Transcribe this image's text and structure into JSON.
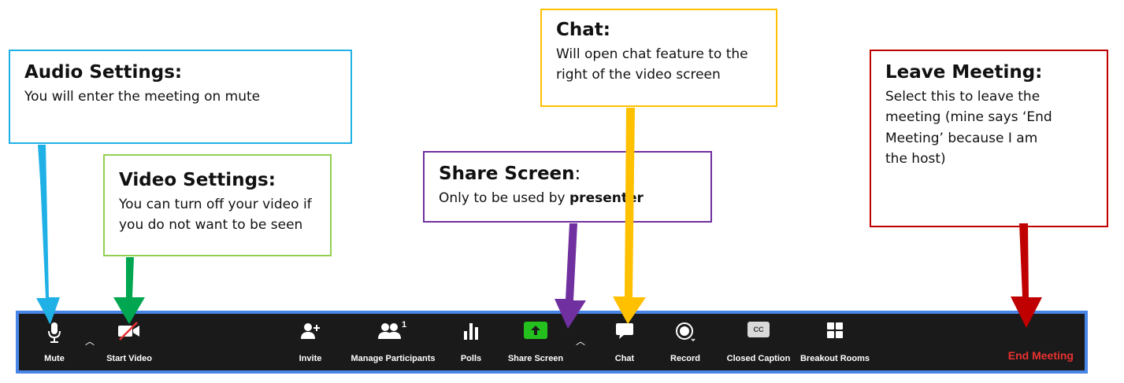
{
  "callouts": {
    "audio": {
      "title": "Audio Settings:",
      "text": "You will enter the meeting on mute"
    },
    "video": {
      "title": "Video Settings:",
      "text_line1": "You can turn off your video if",
      "text_line2": "you do not want to be seen"
    },
    "share": {
      "title": "Share Screen",
      "title_suffix": ":",
      "text": "Only to be used by ",
      "text_bold": "presenter"
    },
    "chat": {
      "title": "Chat:",
      "text_line1": "Will open chat feature to the",
      "text_line2": "right of the video screen"
    },
    "leave": {
      "title": "Leave Meeting:",
      "text_line1": "Select this to leave the",
      "text_line2": "meeting (mine says ‘End",
      "text_line3": "Meeting’ because I am",
      "text_line4": "the host)"
    }
  },
  "toolbar": {
    "mute_label": "Mute",
    "start_video_label": "Start Video",
    "invite_label": "Invite",
    "manage_participants_label": "Manage Participants",
    "participant_count": "1",
    "polls_label": "Polls",
    "share_screen_label": "Share Screen",
    "chat_label": "Chat",
    "record_label": "Record",
    "closed_caption_label": "Closed Caption",
    "closed_caption_icon_text": "CC",
    "breakout_rooms_label": "Breakout Rooms",
    "end_meeting_label": "End Meeting"
  },
  "colors": {
    "audio": "#1fb0e6",
    "video": "#00a650",
    "share": "#7030a0",
    "chat": "#ffc000",
    "leave": "#c00000",
    "end_meeting": "#e8312f",
    "share_button": "#24c11e",
    "toolbar_border": "#4a86e8"
  }
}
